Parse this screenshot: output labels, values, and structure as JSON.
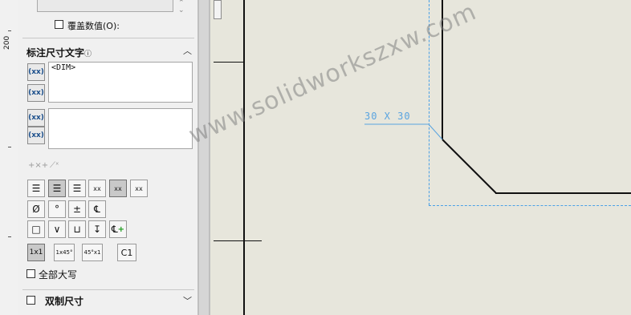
{
  "ruler": {
    "label": "200"
  },
  "override": {
    "label": "覆盖数值(O):"
  },
  "section": {
    "title": "标注尺寸文字",
    "info_icon": "info-icon"
  },
  "text_top": {
    "value": "<DIM>"
  },
  "text_bottom": {
    "value": ""
  },
  "format_row": {
    "items": [
      "<x>",
      "x"
    ]
  },
  "align_row": {
    "items": [
      "left",
      "center",
      "right",
      "xx-above",
      "xx-center",
      "xx-below"
    ]
  },
  "symbol_row": {
    "items": [
      "Ø",
      "°",
      "±",
      "℄"
    ]
  },
  "row3": {
    "items": [
      "□",
      "∨",
      "⊔",
      "↧",
      "℄+"
    ]
  },
  "row4": {
    "items": [
      "1x1",
      "1x45°",
      "45°x1",
      "C1"
    ]
  },
  "all_caps": {
    "label": "全部大写"
  },
  "dual_dim": {
    "label": "双制尺寸"
  },
  "drawing": {
    "dimension_text": "30 X 30"
  },
  "watermark": {
    "text": "www.solidworkszxw.com"
  }
}
